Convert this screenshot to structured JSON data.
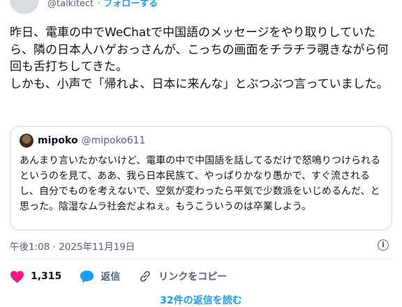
{
  "author": {
    "handle": "@talkitect",
    "follow_label": "フォローする",
    "separator": "·"
  },
  "tweet": {
    "paragraphs": [
      "昨日、電車の中でWeChatで中国語のメッセージをやり取りしていたら、隣の日本人ハゲおっさんが、こっちの画面をチラチラ覗きながら何回も舌打ちしてきた。",
      "しかも、小声で「帰れよ、日本に来んな」とぶつぶつ言っていました。"
    ]
  },
  "quoted_post": {
    "name": "mipoko",
    "handle": "@mipoko611",
    "text": "あんまり言いたかないけど、電車の中で中国語を話してるだけで怒鳴りつけられるというのを見て、ああ、我ら日本民族て、やっぱりかなり愚かで、すぐ流されるし、自分でものを考えないで、空気が変わったら平気で少数派をいじめるんだ、と思った。陰湿なムラ社会だよねぇ。もうこういうのは卒業しよう。"
  },
  "timestamp": "午後1:08 · 2025年11月19日",
  "actions": {
    "like_count": "1,315",
    "reply_label": "返信",
    "copy_link_label": "リンクをコピー"
  },
  "footer": {
    "read_replies_label": "32件の返信を読む"
  },
  "colors": {
    "accent": "#1d9bf0",
    "like": "#f91880",
    "text": "#0f1419",
    "muted": "#536471"
  },
  "icons": [
    "info-icon",
    "heart-icon",
    "reply-icon",
    "link-icon"
  ]
}
